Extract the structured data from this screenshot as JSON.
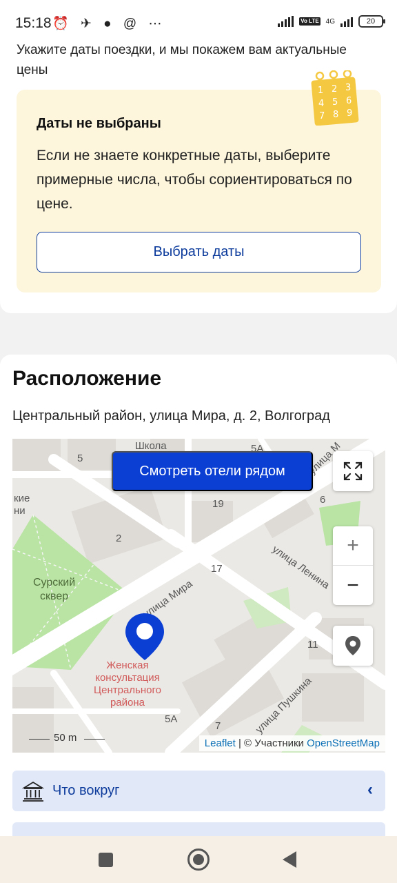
{
  "status_bar": {
    "time": "15:18",
    "icons": "⏰ ✈ ● @ ⋯",
    "volte": "Vo LTE",
    "network": "4G",
    "battery": "20"
  },
  "dates": {
    "intro": "Укажите даты поездки, и мы покажем вам актуальные цены",
    "notice_title": "Даты не выбраны",
    "notice_text": "Если не знаете конкретные даты, выберите примерные числа, чтобы сориентироваться по цене.",
    "choose_button": "Выбрать даты",
    "calendar_numbers": [
      "1",
      "2",
      "3",
      "4",
      "5",
      "6",
      "7",
      "8",
      "9"
    ]
  },
  "location": {
    "title": "Расположение",
    "address": "Центральный район, улица Мира, д. 2, Волгоград",
    "map": {
      "hotels_button": "Смотреть отели рядом",
      "zoom_in": "+",
      "zoom_out": "−",
      "scale": "50 m",
      "attribution_leaflet": "Leaflet",
      "attribution_sep": " | © Участники ",
      "attribution_osm": "OpenStreetMap",
      "labels": {
        "school": "Школа",
        "n5": "5",
        "n5a_top": "5А",
        "n19": "19",
        "n6": "6",
        "n2": "2",
        "n17": "17",
        "n11": "11",
        "n5a_bottom": "5А",
        "n7": "7",
        "street_mira_top": "улица М",
        "street_mira": "улица Мира",
        "street_lenina": "улица Ленина",
        "street_pushkina": "улица Пушкина",
        "park_line1": "Сурский",
        "park_line2": "сквер",
        "left_edge_1": "кие",
        "left_edge_2": "ни",
        "clinic": "Женская консультация Центрального района"
      }
    },
    "nearby_label": "Что вокруг"
  },
  "colors": {
    "primary": "#0b3fd4",
    "link": "#0c3b9c",
    "notice_bg": "#fdf6dc",
    "accordion_bg": "#e1e8f8"
  }
}
